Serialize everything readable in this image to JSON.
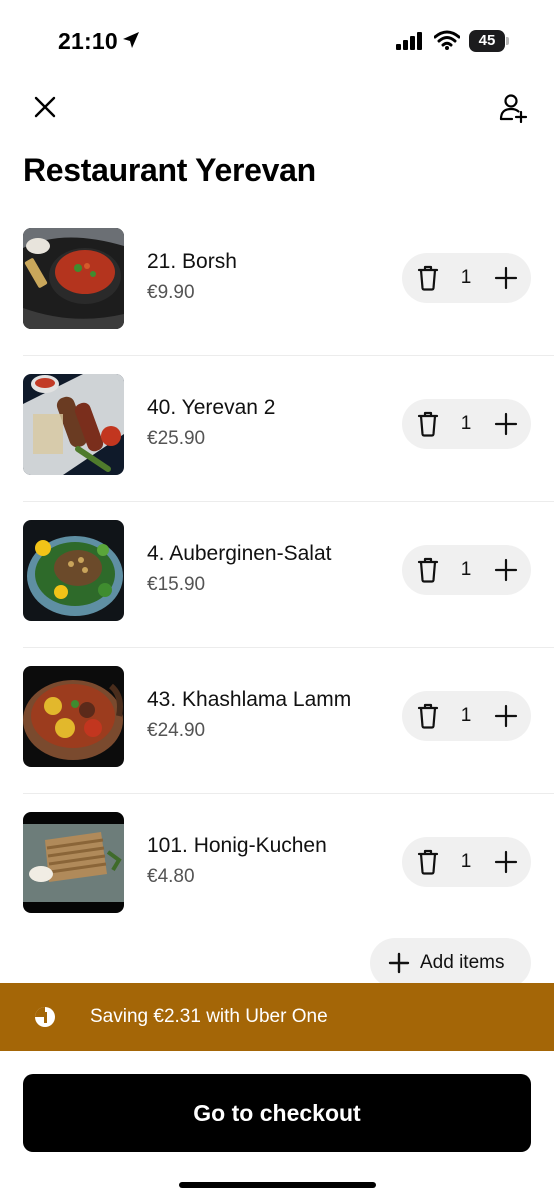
{
  "status_bar": {
    "time": "21:10",
    "battery": "45"
  },
  "restaurant": {
    "name": "Restaurant Yerevan"
  },
  "cart": {
    "items": [
      {
        "name": "21. Borsh",
        "price": "€9.90",
        "quantity": "1"
      },
      {
        "name": "40. Yerevan 2",
        "price": "€25.90",
        "quantity": "1"
      },
      {
        "name": "4. Auberginen-Salat",
        "price": "€15.90",
        "quantity": "1"
      },
      {
        "name": "43. Khashlama Lamm",
        "price": "€24.90",
        "quantity": "1"
      },
      {
        "name": "101. Honig-Kuchen",
        "price": "€4.80",
        "quantity": "1"
      }
    ],
    "add_items_label": "Add items"
  },
  "savings": {
    "text": "Saving €2.31 with Uber One"
  },
  "checkout": {
    "label": "Go to checkout"
  },
  "colors": {
    "savings_banner": "#a46607",
    "checkout_button": "#000000",
    "stepper_bg": "#f0f0f0"
  }
}
